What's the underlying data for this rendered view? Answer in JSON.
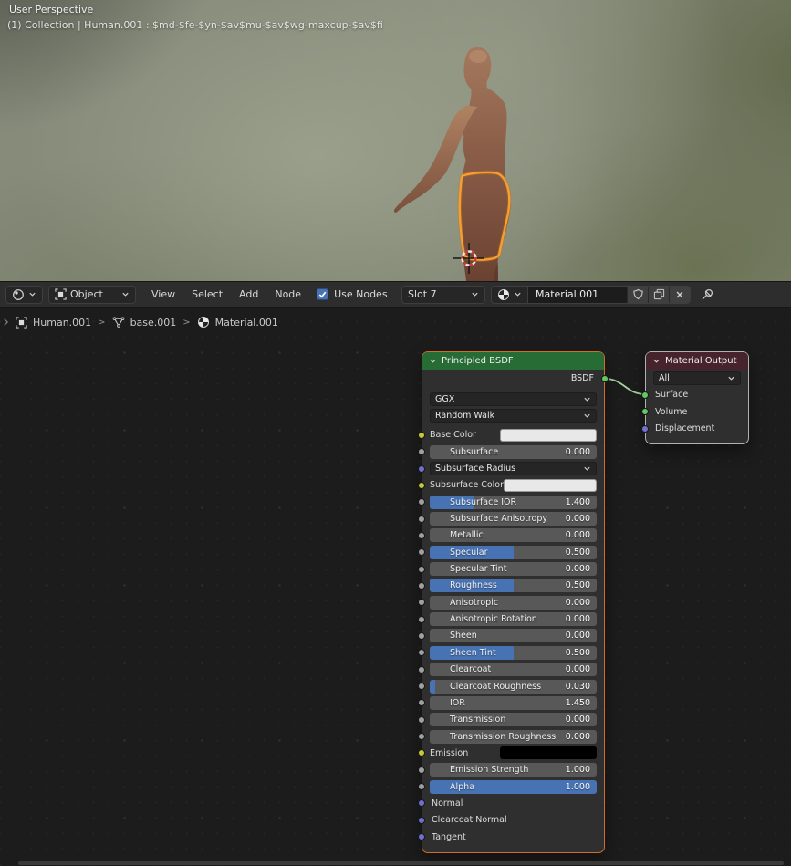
{
  "viewport": {
    "view_label": "User Perspective",
    "context_label": "(1) Collection | Human.001 : $md-$fe-$yn-$av$mu-$av$wg-maxcup-$av$fi"
  },
  "header": {
    "mode_label": "Object",
    "menus": [
      "View",
      "Select",
      "Add",
      "Node"
    ],
    "use_nodes_label": "Use Nodes",
    "slot_label": "Slot 7",
    "material_name": "Material.001"
  },
  "breadcrumb": {
    "separator": ">",
    "items": [
      {
        "label": "Human.001",
        "icon": "object-icon"
      },
      {
        "label": "base.001",
        "icon": "mesh-data-icon"
      },
      {
        "label": "Material.001",
        "icon": "material-icon"
      }
    ]
  },
  "nodes": {
    "principled": {
      "title": "Principled BSDF",
      "output": {
        "label": "BSDF",
        "socket": "green"
      },
      "distribution": "GGX",
      "subsurface_method": "Random Walk",
      "params": [
        {
          "label": "Base Color",
          "type": "color",
          "socket": "yellow",
          "swatch": "#e8e8e8"
        },
        {
          "label": "Subsurface",
          "type": "slider",
          "value": "0.000",
          "fill": 0,
          "socket": "gray"
        },
        {
          "label": "Subsurface Radius",
          "type": "dropdown",
          "socket": "vector"
        },
        {
          "label": "Subsurface Color",
          "type": "color",
          "socket": "yellow",
          "swatch": "#e8e8e8"
        },
        {
          "label": "Subsurface IOR",
          "type": "slider",
          "value": "1.400",
          "fill": 0.27,
          "socket": "gray"
        },
        {
          "label": "Subsurface Anisotropy",
          "type": "slider",
          "value": "0.000",
          "fill": 0,
          "socket": "gray"
        },
        {
          "label": "Metallic",
          "type": "slider",
          "value": "0.000",
          "fill": 0,
          "socket": "gray"
        },
        {
          "label": "Specular",
          "type": "slider",
          "value": "0.500",
          "fill": 0.5,
          "socket": "gray"
        },
        {
          "label": "Specular Tint",
          "type": "slider",
          "value": "0.000",
          "fill": 0,
          "socket": "gray"
        },
        {
          "label": "Roughness",
          "type": "slider",
          "value": "0.500",
          "fill": 0.5,
          "socket": "gray"
        },
        {
          "label": "Anisotropic",
          "type": "slider",
          "value": "0.000",
          "fill": 0,
          "socket": "gray"
        },
        {
          "label": "Anisotropic Rotation",
          "type": "slider",
          "value": "0.000",
          "fill": 0,
          "socket": "gray"
        },
        {
          "label": "Sheen",
          "type": "slider",
          "value": "0.000",
          "fill": 0,
          "socket": "gray"
        },
        {
          "label": "Sheen Tint",
          "type": "slider",
          "value": "0.500",
          "fill": 0.5,
          "socket": "gray"
        },
        {
          "label": "Clearcoat",
          "type": "slider",
          "value": "0.000",
          "fill": 0,
          "socket": "gray"
        },
        {
          "label": "Clearcoat Roughness",
          "type": "slider",
          "value": "0.030",
          "fill": 0.035,
          "socket": "gray"
        },
        {
          "label": "IOR",
          "type": "slider",
          "value": "1.450",
          "fill": 0,
          "socket": "gray"
        },
        {
          "label": "Transmission",
          "type": "slider",
          "value": "0.000",
          "fill": 0,
          "socket": "gray"
        },
        {
          "label": "Transmission Roughness",
          "type": "slider",
          "value": "0.000",
          "fill": 0,
          "socket": "gray"
        },
        {
          "label": "Emission",
          "type": "color",
          "socket": "yellow",
          "swatch": "#000000"
        },
        {
          "label": "Emission Strength",
          "type": "slider",
          "value": "1.000",
          "fill": 0,
          "socket": "gray"
        },
        {
          "label": "Alpha",
          "type": "slider",
          "value": "1.000",
          "fill": 1,
          "socket": "gray"
        },
        {
          "label": "Normal",
          "type": "label",
          "socket": "vector"
        },
        {
          "label": "Clearcoat Normal",
          "type": "label",
          "socket": "vector"
        },
        {
          "label": "Tangent",
          "type": "label",
          "socket": "vector"
        }
      ]
    },
    "material_output": {
      "title": "Material Output",
      "target": "All",
      "inputs": [
        {
          "label": "Surface",
          "socket": "green"
        },
        {
          "label": "Volume",
          "socket": "green"
        },
        {
          "label": "Displacement",
          "socket": "vector"
        }
      ]
    }
  },
  "colors": {
    "accent_blue": "#4772b3",
    "node_header_shader": "#276b35",
    "node_header_output": "#47232e",
    "selected_node_border": "#cf6d2d",
    "active_node_border": "#b0b0b0",
    "link": "#a5d6a0",
    "socket_gray": "#a0a0a0",
    "socket_yellow": "#c8c832",
    "socket_vector": "#7070d0",
    "socket_green": "#63c763",
    "slider_fill": "#4772b3",
    "outline_orange": "#f79e30"
  }
}
